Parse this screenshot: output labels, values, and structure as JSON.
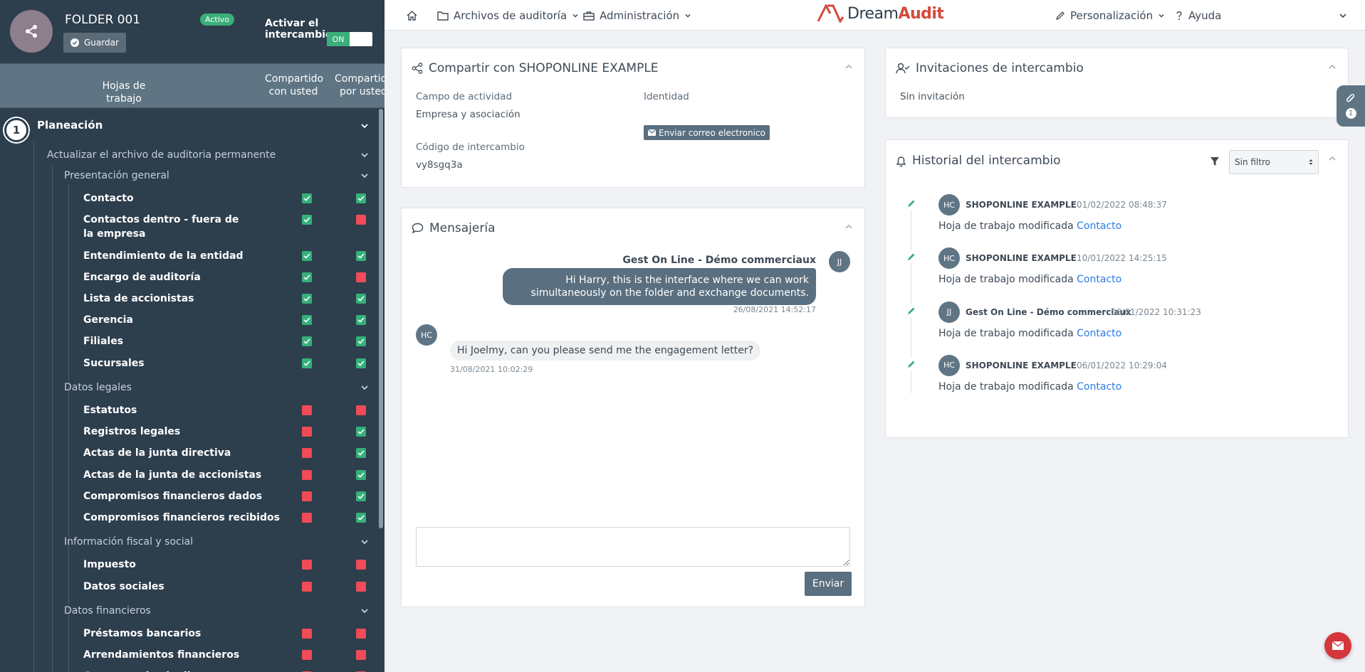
{
  "sidebar": {
    "folder_name": "FOLDER 001",
    "status_badge": "Activo",
    "save_label": "Guardar",
    "exchange_toggle_label": "Activar el intercambio",
    "toggle_on": "ON",
    "columns": {
      "worksheets": "Hojas de trabajo",
      "shared_with_you_line1": "Compartido",
      "shared_with_you_line2": "con usted",
      "shared_by_you_line1": "Compartido",
      "shared_by_you_line2": "por usted"
    },
    "section_number": "1",
    "section_title": "Planeación",
    "group_title": "Actualizar el archivo de auditoria permanente",
    "subgroups": [
      {
        "title": "Presentación general",
        "items": [
          {
            "label": "Contacto",
            "with_you": "green",
            "by_you": "green"
          },
          {
            "label": "Contactos dentro - fuera de la empresa",
            "with_you": "green",
            "by_you": "red"
          },
          {
            "label": "Entendimiento de la entidad",
            "with_you": "green",
            "by_you": "green"
          },
          {
            "label": "Encargo de auditoría",
            "with_you": "green",
            "by_you": "red"
          },
          {
            "label": "Lista de accionistas",
            "with_you": "green",
            "by_you": "green"
          },
          {
            "label": "Gerencia",
            "with_you": "green",
            "by_you": "green"
          },
          {
            "label": "Filiales",
            "with_you": "green",
            "by_you": "green"
          },
          {
            "label": "Sucursales",
            "with_you": "green",
            "by_you": "green"
          }
        ]
      },
      {
        "title": "Datos legales",
        "items": [
          {
            "label": "Estatutos",
            "with_you": "red",
            "by_you": "red"
          },
          {
            "label": "Registros legales",
            "with_you": "red",
            "by_you": "green"
          },
          {
            "label": "Actas de la junta directiva",
            "with_you": "red",
            "by_you": "green"
          },
          {
            "label": "Actas de la junta de accionistas",
            "with_you": "red",
            "by_you": "green"
          },
          {
            "label": "Compromisos financieros dados",
            "with_you": "red",
            "by_you": "green"
          },
          {
            "label": "Compromisos financieros recibidos",
            "with_you": "red",
            "by_you": "green"
          }
        ]
      },
      {
        "title": "Información fiscal y social",
        "items": [
          {
            "label": "Impuesto",
            "with_you": "red",
            "by_you": "red"
          },
          {
            "label": "Datos sociales",
            "with_you": "red",
            "by_you": "red"
          }
        ]
      },
      {
        "title": "Datos financieros",
        "items": [
          {
            "label": "Préstamos bancarios",
            "with_you": "red",
            "by_you": "red"
          },
          {
            "label": "Arrendamientos financieros",
            "with_you": "red",
            "by_you": "red"
          },
          {
            "label": "Contratos de alquiler",
            "with_you": "red",
            "by_you": "red"
          }
        ]
      }
    ]
  },
  "topbar": {
    "audit_files": "Archivos de auditoría",
    "administration": "Administración",
    "logo_prefix": "Dream",
    "logo_suffix": "Audit",
    "personalization": "Personalización",
    "help": "Ayuda"
  },
  "share_panel": {
    "title": "Compartir con SHOPONLINE EXAMPLE",
    "activity_label": "Campo de actividad",
    "activity_value": "Empresa y asociación",
    "identity_label": "Identidad",
    "email_button": "Enviar correo electronico",
    "exchange_code_label": "Código de intercambio",
    "exchange_code_value": "vy8sgq3a"
  },
  "messaging_panel": {
    "title": "Mensajería",
    "messages": [
      {
        "author": "Gest On Line - Démo commerciaux",
        "initials": "JJ",
        "text": "Hi Harry, this is the interface where we can work simultaneously on the folder and exchange documents.",
        "time": "26/08/2021 14:52:17"
      },
      {
        "initials": "HC",
        "text": "Hi Joelmy, can you please send me the engagement letter?",
        "time": "31/08/2021 10:02:29"
      }
    ],
    "send_button": "Enviar"
  },
  "invitations_panel": {
    "title": "Invitaciones de intercambio",
    "empty_text": "Sin invitación"
  },
  "history_panel": {
    "title": "Historial del intercambio",
    "filter_value": "Sin filtro",
    "entries": [
      {
        "initials": "HC",
        "name": "SHOPONLINE EXAMPLE",
        "date": "01/02/2022 08:48:37",
        "action": "Hoja de trabajo modificada",
        "link": "Contacto"
      },
      {
        "initials": "HC",
        "name": "SHOPONLINE EXAMPLE",
        "date": "10/01/2022 14:25:15",
        "action": "Hoja de trabajo modificada",
        "link": "Contacto"
      },
      {
        "initials": "JJ",
        "name": "Gest On Line - Démo commerciaux",
        "date": "06/01/2022 10:31:23",
        "action": "Hoja de trabajo modificada",
        "link": "Contacto"
      },
      {
        "initials": "HC",
        "name": "SHOPONLINE EXAMPLE",
        "date": "06/01/2022 10:29:04",
        "action": "Hoja de trabajo modificada",
        "link": "Contacto"
      }
    ]
  },
  "attachments": {
    "count": "1"
  },
  "colors": {
    "sidebar_bg": "#2d3e4d",
    "check_green": "#35b079",
    "check_red": "#f04b57",
    "accent": "#5a6f7f",
    "link": "#2c7be5"
  }
}
